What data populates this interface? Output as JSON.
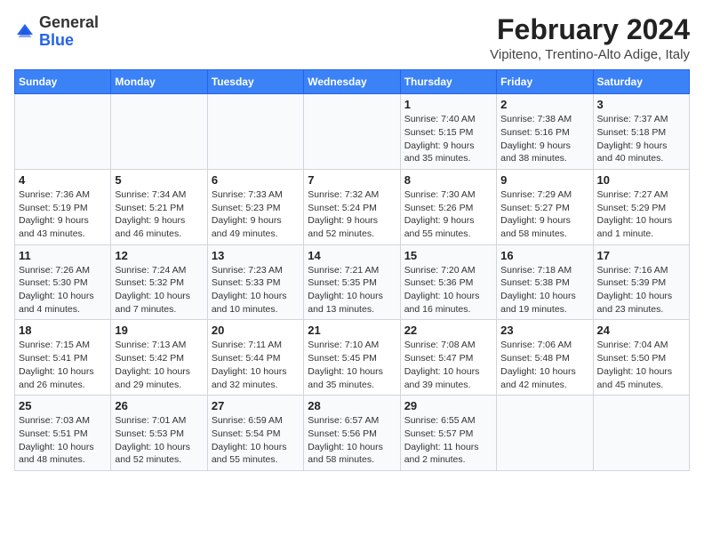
{
  "header": {
    "logo_general": "General",
    "logo_blue": "Blue",
    "title": "February 2024",
    "subtitle": "Vipiteno, Trentino-Alto Adige, Italy"
  },
  "weekdays": [
    "Sunday",
    "Monday",
    "Tuesday",
    "Wednesday",
    "Thursday",
    "Friday",
    "Saturday"
  ],
  "weeks": [
    [
      {
        "day": "",
        "info": ""
      },
      {
        "day": "",
        "info": ""
      },
      {
        "day": "",
        "info": ""
      },
      {
        "day": "",
        "info": ""
      },
      {
        "day": "1",
        "info": "Sunrise: 7:40 AM\nSunset: 5:15 PM\nDaylight: 9 hours\nand 35 minutes."
      },
      {
        "day": "2",
        "info": "Sunrise: 7:38 AM\nSunset: 5:16 PM\nDaylight: 9 hours\nand 38 minutes."
      },
      {
        "day": "3",
        "info": "Sunrise: 7:37 AM\nSunset: 5:18 PM\nDaylight: 9 hours\nand 40 minutes."
      }
    ],
    [
      {
        "day": "4",
        "info": "Sunrise: 7:36 AM\nSunset: 5:19 PM\nDaylight: 9 hours\nand 43 minutes."
      },
      {
        "day": "5",
        "info": "Sunrise: 7:34 AM\nSunset: 5:21 PM\nDaylight: 9 hours\nand 46 minutes."
      },
      {
        "day": "6",
        "info": "Sunrise: 7:33 AM\nSunset: 5:23 PM\nDaylight: 9 hours\nand 49 minutes."
      },
      {
        "day": "7",
        "info": "Sunrise: 7:32 AM\nSunset: 5:24 PM\nDaylight: 9 hours\nand 52 minutes."
      },
      {
        "day": "8",
        "info": "Sunrise: 7:30 AM\nSunset: 5:26 PM\nDaylight: 9 hours\nand 55 minutes."
      },
      {
        "day": "9",
        "info": "Sunrise: 7:29 AM\nSunset: 5:27 PM\nDaylight: 9 hours\nand 58 minutes."
      },
      {
        "day": "10",
        "info": "Sunrise: 7:27 AM\nSunset: 5:29 PM\nDaylight: 10 hours\nand 1 minute."
      }
    ],
    [
      {
        "day": "11",
        "info": "Sunrise: 7:26 AM\nSunset: 5:30 PM\nDaylight: 10 hours\nand 4 minutes."
      },
      {
        "day": "12",
        "info": "Sunrise: 7:24 AM\nSunset: 5:32 PM\nDaylight: 10 hours\nand 7 minutes."
      },
      {
        "day": "13",
        "info": "Sunrise: 7:23 AM\nSunset: 5:33 PM\nDaylight: 10 hours\nand 10 minutes."
      },
      {
        "day": "14",
        "info": "Sunrise: 7:21 AM\nSunset: 5:35 PM\nDaylight: 10 hours\nand 13 minutes."
      },
      {
        "day": "15",
        "info": "Sunrise: 7:20 AM\nSunset: 5:36 PM\nDaylight: 10 hours\nand 16 minutes."
      },
      {
        "day": "16",
        "info": "Sunrise: 7:18 AM\nSunset: 5:38 PM\nDaylight: 10 hours\nand 19 minutes."
      },
      {
        "day": "17",
        "info": "Sunrise: 7:16 AM\nSunset: 5:39 PM\nDaylight: 10 hours\nand 23 minutes."
      }
    ],
    [
      {
        "day": "18",
        "info": "Sunrise: 7:15 AM\nSunset: 5:41 PM\nDaylight: 10 hours\nand 26 minutes."
      },
      {
        "day": "19",
        "info": "Sunrise: 7:13 AM\nSunset: 5:42 PM\nDaylight: 10 hours\nand 29 minutes."
      },
      {
        "day": "20",
        "info": "Sunrise: 7:11 AM\nSunset: 5:44 PM\nDaylight: 10 hours\nand 32 minutes."
      },
      {
        "day": "21",
        "info": "Sunrise: 7:10 AM\nSunset: 5:45 PM\nDaylight: 10 hours\nand 35 minutes."
      },
      {
        "day": "22",
        "info": "Sunrise: 7:08 AM\nSunset: 5:47 PM\nDaylight: 10 hours\nand 39 minutes."
      },
      {
        "day": "23",
        "info": "Sunrise: 7:06 AM\nSunset: 5:48 PM\nDaylight: 10 hours\nand 42 minutes."
      },
      {
        "day": "24",
        "info": "Sunrise: 7:04 AM\nSunset: 5:50 PM\nDaylight: 10 hours\nand 45 minutes."
      }
    ],
    [
      {
        "day": "25",
        "info": "Sunrise: 7:03 AM\nSunset: 5:51 PM\nDaylight: 10 hours\nand 48 minutes."
      },
      {
        "day": "26",
        "info": "Sunrise: 7:01 AM\nSunset: 5:53 PM\nDaylight: 10 hours\nand 52 minutes."
      },
      {
        "day": "27",
        "info": "Sunrise: 6:59 AM\nSunset: 5:54 PM\nDaylight: 10 hours\nand 55 minutes."
      },
      {
        "day": "28",
        "info": "Sunrise: 6:57 AM\nSunset: 5:56 PM\nDaylight: 10 hours\nand 58 minutes."
      },
      {
        "day": "29",
        "info": "Sunrise: 6:55 AM\nSunset: 5:57 PM\nDaylight: 11 hours\nand 2 minutes."
      },
      {
        "day": "",
        "info": ""
      },
      {
        "day": "",
        "info": ""
      }
    ]
  ]
}
